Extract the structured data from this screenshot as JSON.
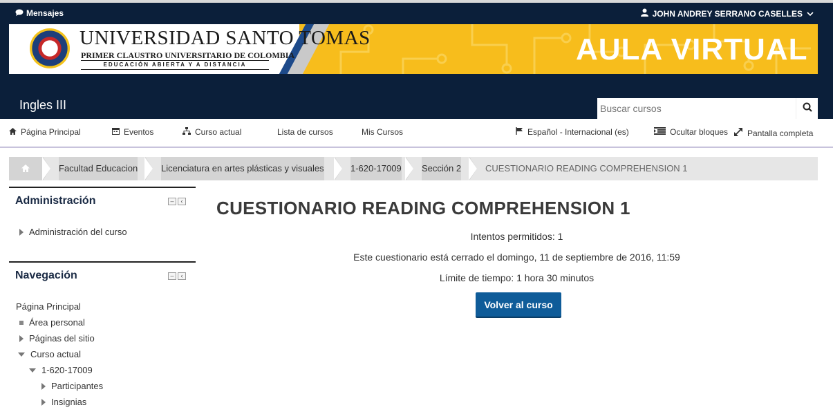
{
  "topbar": {
    "messages_label": "Mensajes",
    "user_name": "JOHN ANDREY SERRANO CASELLES"
  },
  "banner": {
    "university_name": "UNIVERSIDAD SANTO TOMAS",
    "university_subtitle": "PRIMER CLAUSTRO UNIVERSITARIO DE COLOMBIA",
    "university_tagline": "EDUCACIÓN ABIERTA Y A DISTANCIA",
    "platform_title": "AULA VIRTUAL",
    "colors": {
      "brand_navy": "#0b1f3a",
      "accent_yellow": "#f7bd1c",
      "accent_blue": "#1d4a8a"
    }
  },
  "header": {
    "course_title": "Ingles III",
    "search_placeholder": "Buscar cursos"
  },
  "nav": {
    "home": "Página Principal",
    "events": "Eventos",
    "current_course": "Curso actual",
    "course_list": "Lista de cursos",
    "my_courses": "Mis Cursos",
    "language": "Español - Internacional (es)",
    "hide_blocks": "Ocultar bloques",
    "fullscreen": "Pantalla completa"
  },
  "breadcrumb": {
    "items": [
      "Facultad Educacion",
      "Licenciatura en artes plásticas y visuales",
      "1-620-17009",
      "Sección 2"
    ],
    "current": "CUESTIONARIO READING COMPREHENSION 1"
  },
  "admin_block": {
    "title": "Administración",
    "items": [
      "Administración del curso"
    ]
  },
  "nav_block": {
    "title": "Navegación",
    "home": "Página Principal",
    "items": [
      "Área personal",
      "Páginas del sitio",
      "Curso actual",
      "1-620-17009",
      "Participantes",
      "Insignias"
    ]
  },
  "quiz": {
    "title": "CUESTIONARIO READING COMPREHENSION 1",
    "attempts": "Intentos permitidos: 1",
    "closed": "Este cuestionario está cerrado el domingo, 11 de septiembre de 2016, 11:59",
    "time_limit": "Límite de tiempo: 1 hora 30 minutos",
    "back_button": "Volver al curso"
  }
}
